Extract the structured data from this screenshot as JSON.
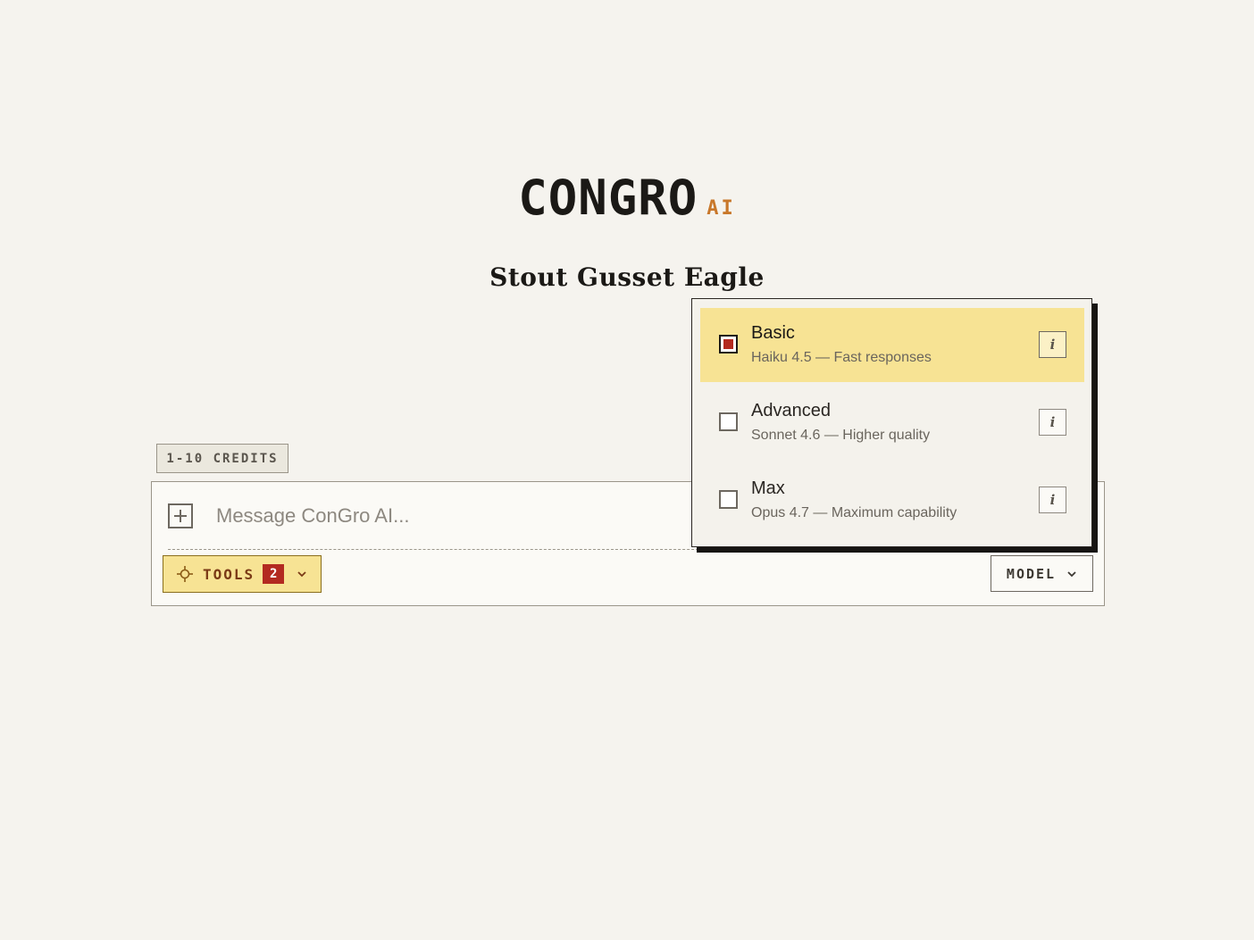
{
  "brand": {
    "name": "CONGRO",
    "suffix": "AI"
  },
  "session": {
    "title": "Stout Gusset Eagle"
  },
  "credits": {
    "label": "1-10 CREDITS"
  },
  "composer": {
    "placeholder": "Message ConGro AI...",
    "value": "",
    "attach_icon": "plus-square-icon",
    "tools": {
      "label": "TOOLS",
      "count": "2",
      "icon": "crosshair-icon"
    },
    "model": {
      "label": "MODEL"
    }
  },
  "model_menu": {
    "options": [
      {
        "title": "Basic",
        "description": "Haiku 4.5 — Fast responses",
        "selected": true,
        "info": "i"
      },
      {
        "title": "Advanced",
        "description": "Sonnet 4.6 — Higher quality",
        "selected": false,
        "info": "i"
      },
      {
        "title": "Max",
        "description": "Opus 4.7 — Maximum capability",
        "selected": false,
        "info": "i"
      }
    ]
  },
  "colors": {
    "background": "#f5f3ee",
    "accent_yellow": "#f7e394",
    "accent_red": "#b32a20",
    "brand_orange": "#c8772a"
  }
}
